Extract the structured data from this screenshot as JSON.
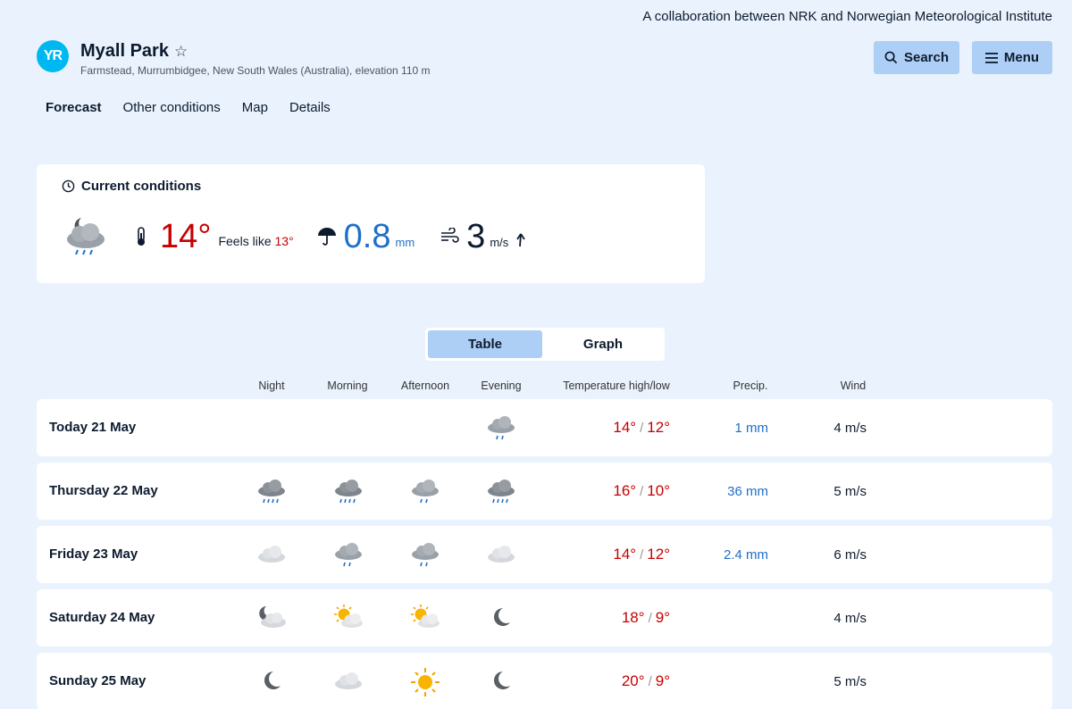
{
  "header": {
    "collaboration": "A collaboration between NRK and Norwegian Meteorological Institute",
    "logo": "YR",
    "location_name": "Myall Park",
    "location_sub": "Farmstead, Murrumbidgee, New South Wales (Australia), elevation 110 m",
    "search_label": "Search",
    "menu_label": "Menu"
  },
  "tabs": [
    "Forecast",
    "Other conditions",
    "Map",
    "Details"
  ],
  "current": {
    "heading": "Current conditions",
    "temp": "14°",
    "feels_label": "Feels like",
    "feels_value": "13°",
    "precip": "0.8",
    "precip_unit": "mm",
    "wind": "3",
    "wind_unit": "m/s"
  },
  "toggle": {
    "table": "Table",
    "graph": "Graph"
  },
  "columns": {
    "night": "Night",
    "morning": "Morning",
    "afternoon": "Afternoon",
    "evening": "Evening",
    "temp": "Temperature high/low",
    "precip": "Precip.",
    "wind": "Wind"
  },
  "days": [
    {
      "day": "Today 21 May",
      "high": "14°",
      "low": "12°",
      "precip": "1 mm",
      "wind": "4 m/s",
      "icons": [
        "",
        "",
        "",
        "rain-light"
      ]
    },
    {
      "day": "Thursday 22 May",
      "high": "16°",
      "low": "10°",
      "precip": "36 mm",
      "wind": "5 m/s",
      "icons": [
        "rain-heavy",
        "rain-heavy",
        "rain-light",
        "rain-heavy"
      ]
    },
    {
      "day": "Friday 23 May",
      "high": "14°",
      "low": "12°",
      "precip": "2.4 mm",
      "wind": "6 m/s",
      "icons": [
        "cloud",
        "rain-light",
        "rain-light",
        "cloud"
      ]
    },
    {
      "day": "Saturday 24 May",
      "high": "18°",
      "low": "9°",
      "precip": "",
      "wind": "4 m/s",
      "icons": [
        "moon-cloud",
        "sun-cloud",
        "sun-cloud",
        "moon"
      ]
    },
    {
      "day": "Sunday 25 May",
      "high": "20°",
      "low": "9°",
      "precip": "",
      "wind": "5 m/s",
      "icons": [
        "moon",
        "cloud",
        "sun",
        "moon"
      ]
    }
  ],
  "colors": {
    "background": "#eaf3fd",
    "button": "#aecff5",
    "temp": "#c60000",
    "precip": "#1f6fc9",
    "logo": "#00b8f1"
  }
}
